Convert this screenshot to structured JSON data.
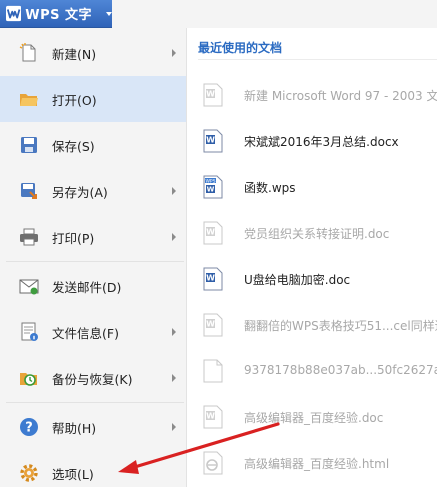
{
  "app": {
    "title": "WPS 文字"
  },
  "menu": {
    "items": [
      {
        "label": "新建(N)",
        "icon": "new-doc-icon",
        "submenu": true
      },
      {
        "label": "打开(O)",
        "icon": "folder-icon",
        "submenu": false
      },
      {
        "label": "保存(S)",
        "icon": "save-icon",
        "submenu": false
      },
      {
        "label": "另存为(A)",
        "icon": "save-as-icon",
        "submenu": true
      },
      {
        "label": "打印(P)",
        "icon": "printer-icon",
        "submenu": true
      },
      {
        "label": "发送邮件(D)",
        "icon": "mail-icon",
        "submenu": false
      },
      {
        "label": "文件信息(F)",
        "icon": "info-icon",
        "submenu": true
      },
      {
        "label": "备份与恢复(K)",
        "icon": "backup-icon",
        "submenu": true
      },
      {
        "label": "帮助(H)",
        "icon": "help-icon",
        "submenu": true
      },
      {
        "label": "选项(L)",
        "icon": "gear-icon",
        "submenu": false
      }
    ]
  },
  "recent": {
    "title": "最近使用的文档",
    "docs": [
      {
        "name": "新建 Microsoft Word 97 - 2003 文",
        "available": false,
        "type": "word"
      },
      {
        "name": "宋斌斌2016年3月总结.docx",
        "available": true,
        "type": "word"
      },
      {
        "name": "函数.wps",
        "available": true,
        "type": "wps"
      },
      {
        "name": "党员组织关系转接证明.doc",
        "available": false,
        "type": "word"
      },
      {
        "name": "U盘给电脑加密.doc",
        "available": true,
        "type": "word"
      },
      {
        "name": "翻翻倍的WPS表格技巧51...cel同样适",
        "available": false,
        "type": "word"
      },
      {
        "name": "9378178b88e037ab...50fc2627a5",
        "available": false,
        "type": "blank"
      },
      {
        "name": "高级编辑器_百度经验.doc",
        "available": false,
        "type": "word"
      },
      {
        "name": "高级编辑器_百度经验.html",
        "available": false,
        "type": "html"
      }
    ]
  },
  "colors": {
    "accent": "#2b6bc2",
    "annotation_arrow": "#d92121",
    "active_item": "#d9e6f7"
  }
}
